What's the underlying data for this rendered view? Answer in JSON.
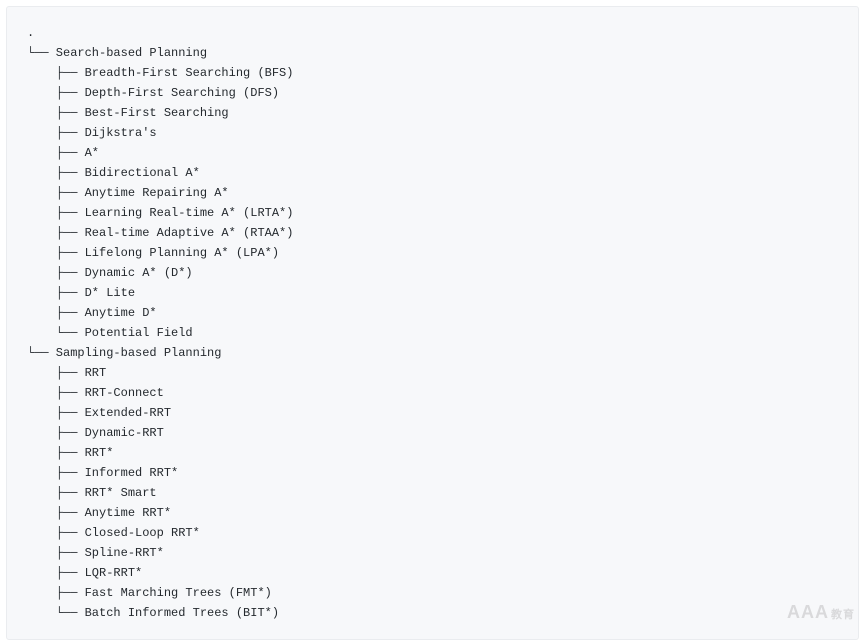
{
  "tree": {
    "root_symbol": ".",
    "sections": [
      {
        "label": "Search-based Planning",
        "branch": "└──",
        "children": [
          {
            "branch": "├──",
            "label": "Breadth-First Searching (BFS)"
          },
          {
            "branch": "├──",
            "label": "Depth-First Searching (DFS)"
          },
          {
            "branch": "├──",
            "label": "Best-First Searching"
          },
          {
            "branch": "├──",
            "label": "Dijkstra's"
          },
          {
            "branch": "├──",
            "label": "A*"
          },
          {
            "branch": "├──",
            "label": "Bidirectional A*"
          },
          {
            "branch": "├──",
            "label": "Anytime Repairing A*"
          },
          {
            "branch": "├──",
            "label": "Learning Real-time A* (LRTA*)"
          },
          {
            "branch": "├──",
            "label": "Real-time Adaptive A* (RTAA*)"
          },
          {
            "branch": "├──",
            "label": "Lifelong Planning A* (LPA*)"
          },
          {
            "branch": "├──",
            "label": "Dynamic A* (D*)"
          },
          {
            "branch": "├──",
            "label": "D* Lite"
          },
          {
            "branch": "├──",
            "label": "Anytime D*"
          },
          {
            "branch": "└──",
            "label": "Potential Field"
          }
        ]
      },
      {
        "label": "Sampling-based Planning",
        "branch": "└──",
        "children": [
          {
            "branch": "├──",
            "label": "RRT"
          },
          {
            "branch": "├──",
            "label": "RRT-Connect"
          },
          {
            "branch": "├──",
            "label": "Extended-RRT"
          },
          {
            "branch": "├──",
            "label": "Dynamic-RRT"
          },
          {
            "branch": "├──",
            "label": "RRT*"
          },
          {
            "branch": "├──",
            "label": "Informed RRT*"
          },
          {
            "branch": "├──",
            "label": "RRT* Smart"
          },
          {
            "branch": "├──",
            "label": "Anytime RRT*"
          },
          {
            "branch": "├──",
            "label": "Closed-Loop RRT*"
          },
          {
            "branch": "├──",
            "label": "Spline-RRT*"
          },
          {
            "branch": "├──",
            "label": "LQR-RRT*"
          },
          {
            "branch": "├──",
            "label": "Fast Marching Trees (FMT*)"
          },
          {
            "branch": "└──",
            "label": "Batch Informed Trees (BIT*)"
          }
        ]
      }
    ]
  },
  "watermark": {
    "main": "AAA",
    "sub": "教育"
  }
}
